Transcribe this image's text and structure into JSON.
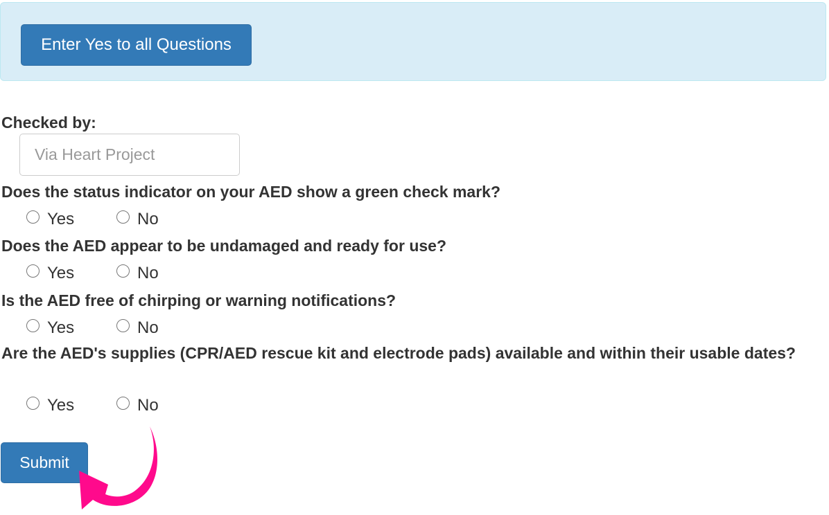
{
  "banner": {
    "yes_all_label": "Enter Yes to all Questions"
  },
  "checked_by": {
    "label": "Checked by:",
    "placeholder": "Via Heart Project",
    "value": ""
  },
  "questions": [
    {
      "text": "Does the status indicator on your AED show a green check mark?",
      "yes": "Yes",
      "no": "No"
    },
    {
      "text": "Does the AED appear to be undamaged and ready for use?",
      "yes": "Yes",
      "no": "No"
    },
    {
      "text": "Is the AED free of chirping or warning notifications?",
      "yes": "Yes",
      "no": "No"
    },
    {
      "text": "Are the AED's supplies (CPR/AED rescue kit and electrode pads) available and within their usable dates?",
      "yes": "Yes",
      "no": "No"
    }
  ],
  "submit_label": "Submit",
  "annotation": {
    "arrow_icon": "curved-arrow-icon",
    "arrow_color": "#ff0a8c"
  },
  "colors": {
    "primary": "#337ab7",
    "banner_bg": "#d9edf7"
  }
}
